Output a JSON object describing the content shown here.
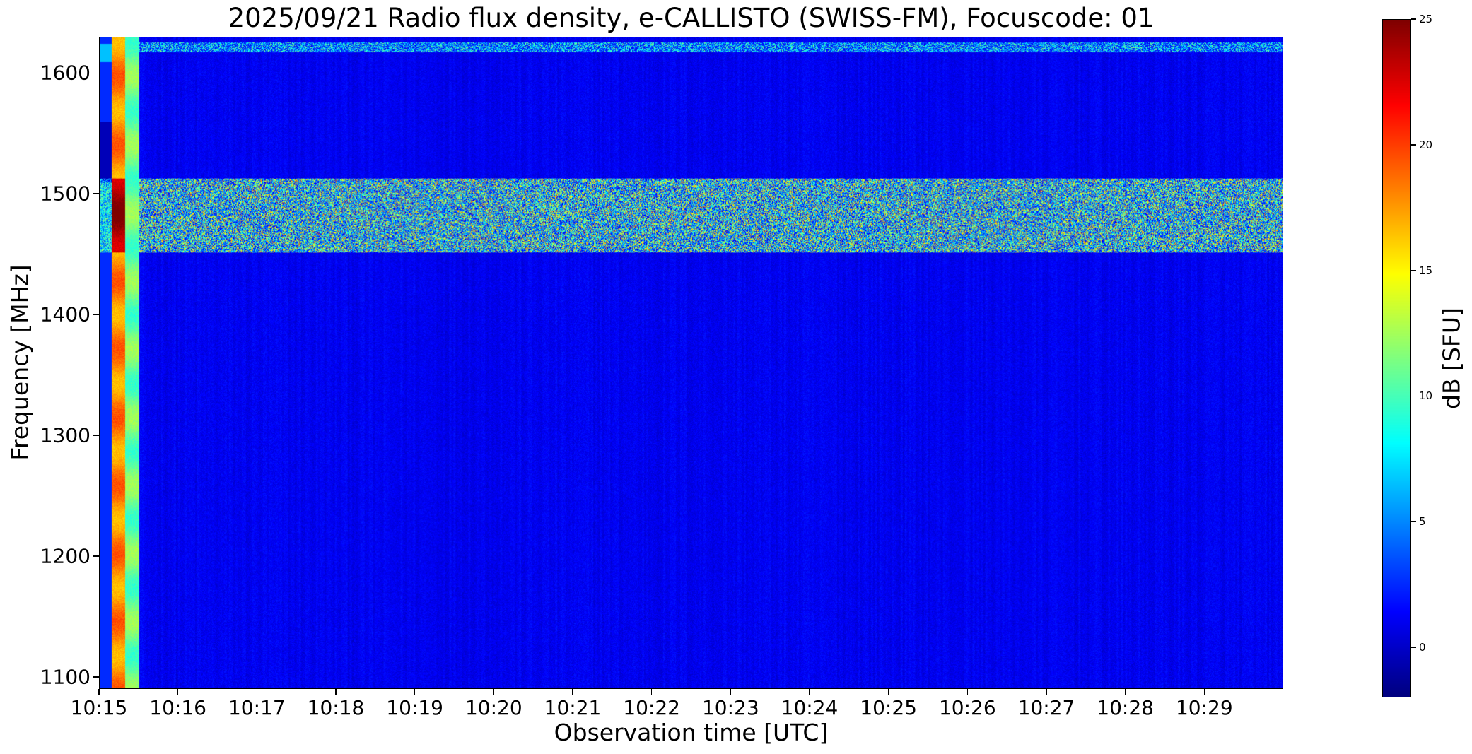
{
  "chart_data": {
    "type": "heatmap",
    "title": "2025/09/21  Radio flux density, e-CALLISTO (SWISS-FM), Focuscode: 01",
    "xlabel": "Observation time [UTC]",
    "ylabel": "Frequency [MHz]",
    "xlim": [
      "10:15:00",
      "10:30:00"
    ],
    "ylim": [
      1090,
      1630
    ],
    "xticks": [
      "10:15",
      "10:16",
      "10:17",
      "10:18",
      "10:19",
      "10:20",
      "10:21",
      "10:22",
      "10:23",
      "10:24",
      "10:25",
      "10:26",
      "10:27",
      "10:28",
      "10:29"
    ],
    "yticks": [
      1100,
      1200,
      1300,
      1400,
      1500,
      1600
    ],
    "grid": false,
    "colormap": "jet",
    "colorbar": {
      "label": "dB [SFU]",
      "range": [
        -2,
        25
      ],
      "ticks": [
        0,
        5,
        10,
        15,
        20,
        25
      ]
    },
    "background_level_db": 1,
    "features": [
      {
        "time_start": "10:15:09",
        "time_end": "10:15:19",
        "freq_range": [
          1090,
          1630
        ],
        "level_db": 18
      },
      {
        "time_start": "10:15:19",
        "time_end": "10:15:30",
        "freq_range": [
          1090,
          1630
        ],
        "level_db": 11
      },
      {
        "time_start": "10:15:30",
        "time_end": "10:30:00",
        "freq_range": [
          1452,
          1513
        ],
        "level_db": 8
      },
      {
        "time_start": "10:15:30",
        "time_end": "10:30:00",
        "freq_range": [
          1618,
          1626
        ],
        "level_db": 5
      }
    ]
  }
}
